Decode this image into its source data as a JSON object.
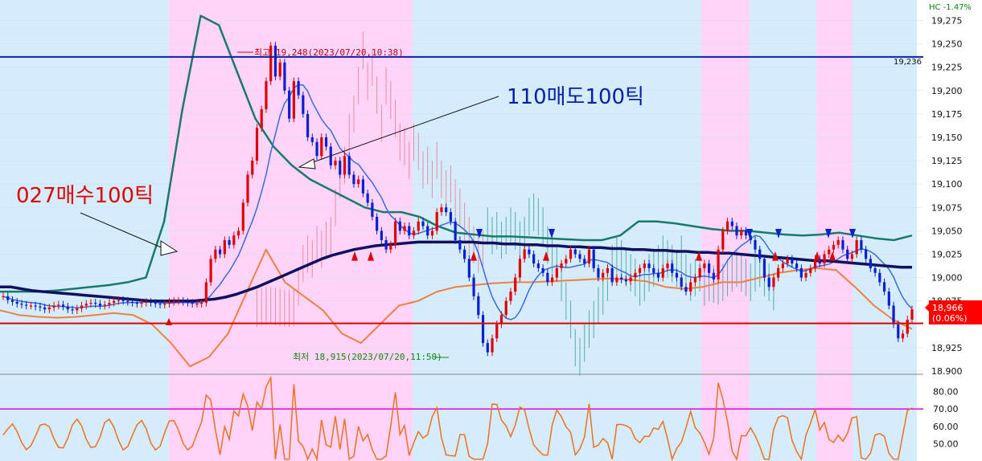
{
  "chart_data": {
    "type": "candlestick",
    "y_range": [
      18900,
      19290
    ],
    "y_ticks": [
      "19,275",
      "19,250",
      "19,225",
      "19,200",
      "19,175",
      "19,150",
      "19,125",
      "19,100",
      "19,075",
      "19,050",
      "19,025",
      "19,000",
      "18,975",
      "18,925",
      "18,900"
    ],
    "y_ticks_values": [
      19275,
      19250,
      19225,
      19200,
      19175,
      19150,
      19125,
      19100,
      19075,
      19050,
      19025,
      19000,
      18975,
      18925,
      18900
    ],
    "top_right_label": "HC  -1.47%",
    "hline_blue": {
      "value": 19236,
      "label": "19,236",
      "color": "#0a1fa8"
    },
    "hline_red": {
      "value": 18951,
      "color": "#e00000"
    },
    "current_price": {
      "value": 18966,
      "label": "18,966",
      "change": "(0.06%)",
      "color": "#ff0000"
    },
    "high_annotation": "최고 19,248(2023/07/20,10:38)",
    "low_annotation": "최저 18,915(2023/07/20,11:50)",
    "buy_annotation": "027매수100틱",
    "sell_annotation": "110매도100틱",
    "osc_ticks": [
      "80.00",
      "70.00",
      "60.00",
      "50.00"
    ],
    "osc_ticks_values": [
      80,
      70,
      60,
      50
    ],
    "osc_range": [
      40,
      90
    ],
    "osc_line": 70,
    "x_start": 0,
    "x_step": 4.8,
    "band_pattern": [
      "blue",
      "pink",
      "blue",
      "pink",
      "blue",
      "pink",
      "blue",
      "pink",
      "blue"
    ],
    "bands": [
      [
        0,
        210
      ],
      [
        210,
        513
      ],
      [
        513,
        872
      ],
      [
        872,
        932
      ],
      [
        932,
        1015
      ],
      [
        1015,
        1060
      ],
      [
        1060,
        1140
      ]
    ],
    "closes": [
      18980,
      18976,
      18974,
      18972,
      18971,
      18970,
      18970,
      18969,
      18968,
      18966,
      18968,
      18970,
      18971,
      18969,
      18966,
      18965,
      18967,
      18970,
      18972,
      18973,
      18972,
      18970,
      18971,
      18973,
      18975,
      18976,
      18975,
      18974,
      18973,
      18972,
      18973,
      18974,
      18973,
      18972,
      18971,
      18972,
      18974,
      18975,
      18975,
      18974,
      18973,
      18972,
      18972,
      18973,
      18995,
      19020,
      19030,
      19025,
      19040,
      19035,
      19045,
      19050,
      19080,
      19110,
      19125,
      19160,
      19180,
      19210,
      19248,
      19215,
      19230,
      19200,
      19170,
      19210,
      19195,
      19175,
      19150,
      19145,
      19130,
      19150,
      19140,
      19120,
      19125,
      19110,
      19130,
      19110,
      19100,
      19105,
      19090,
      19080,
      19065,
      19050,
      19040,
      19030,
      19035,
      19060,
      19050,
      19055,
      19045,
      19050,
      19060,
      19055,
      19045,
      19050,
      19070,
      19075,
      19070,
      19060,
      19040,
      19030,
      19020,
      19000,
      18980,
      18960,
      18930,
      18920,
      18935,
      18950,
      18960,
      18975,
      18985,
      19000,
      19020,
      19030,
      19025,
      19015,
      19010,
      19005,
      18995,
      19000,
      19010,
      19015,
      19020,
      19030,
      19025,
      19020,
      19015,
      19030,
      19010,
      19000,
      19005,
      19010,
      18995,
      19000,
      18998,
      18996,
      19000,
      19005,
      19010,
      19015,
      19010,
      19005,
      19000,
      19010,
      19015,
      19005,
      19000,
      18990,
      18985,
      18995,
      19000,
      19010,
      19015,
      19005,
      18998,
      19030,
      19050,
      19060,
      19055,
      19045,
      19050,
      19045,
      19040,
      19030,
      19020,
      19000,
      18990,
      19000,
      19010,
      19015,
      19020,
      19015,
      19010,
      19000,
      19005,
      19010,
      19020,
      19015,
      19025,
      19030,
      19035,
      19040,
      19030,
      19020,
      19025,
      19040,
      19030,
      19020,
      19010,
      19005,
      18995,
      18985,
      18970,
      18950,
      18935,
      18940,
      18955,
      18966
    ],
    "sma_dark": [
      18990,
      18990,
      18988,
      18986,
      18985,
      18984,
      18983,
      18982,
      18981,
      18980,
      18979,
      18978,
      18977,
      18976,
      18975,
      18975,
      18975,
      18975,
      18975,
      18976,
      18977,
      18979,
      18982,
      18986,
      18990,
      18995,
      19000,
      19005,
      19010,
      19015,
      19020,
      19024,
      19027,
      19030,
      19032,
      19034,
      19035,
      19036,
      19037,
      19038,
      19038,
      19038,
      19038,
      19038,
      19038,
      19037,
      19037,
      19036,
      19036,
      19035,
      19035,
      19034,
      19034,
      19033,
      19033,
      19032,
      19032,
      19031,
      19031,
      19030,
      19030,
      19029,
      19029,
      19028,
      19028,
      19027,
      19027,
      19026,
      19026,
      19025,
      19024,
      19023,
      19022,
      19021,
      19020,
      19019,
      19018,
      19018,
      19017,
      19016,
      19015,
      19014,
      19013,
      19012,
      19011,
      19011
    ],
    "env_upper": [
      18985,
      18985,
      18985,
      18986,
      18988,
      18990,
      18992,
      18995,
      19000,
      19060,
      19180,
      19280,
      19270,
      19220,
      19170,
      19140,
      19120,
      19105,
      19095,
      19085,
      19075,
      19070,
      19070,
      19065,
      19055,
      19048,
      19046,
      19044,
      19044,
      19043,
      19042,
      19041,
      19040,
      19040,
      19045,
      19060,
      19060,
      19058,
      19055,
      19052,
      19050,
      19050,
      19048,
      19046,
      19045,
      19046,
      19048,
      19045,
      19042,
      19040,
      19045
    ],
    "env_lower": [
      18965,
      18960,
      18958,
      18957,
      18958,
      18960,
      18962,
      18960,
      18950,
      18930,
      18905,
      18915,
      18940,
      18985,
      19030,
      18995,
      18980,
      18965,
      18940,
      18930,
      18950,
      18970,
      18975,
      18985,
      18990,
      18992,
      18994,
      18995,
      18995,
      18996,
      18997,
      18998,
      18999,
      18998,
      18996,
      18990,
      18988,
      18990,
      18995,
      18995,
      19000,
      19005,
      19008,
      19010,
      19008,
      18990,
      18970,
      18955,
      18945
    ]
  }
}
